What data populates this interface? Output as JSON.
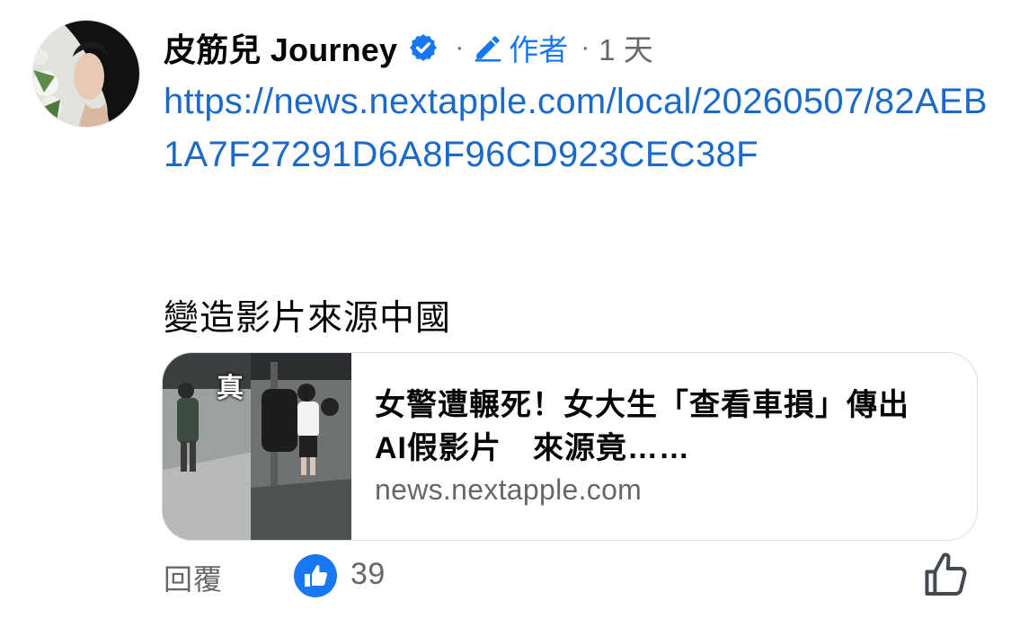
{
  "comment": {
    "author": "皮筋兒 Journey",
    "author_badge": "作者",
    "separator": "·",
    "time": "1 天",
    "link_text": "https://news.nextapple.com/local/20260507/82AEB1A7F27291D6A8F96CD923CEC38F",
    "text": "變造影片來源中國"
  },
  "link_card": {
    "thumbnail_label": "真",
    "title": "女警遭輾死！女大生「查看車損」傳出AI假影片　來源竟……",
    "domain": "news.nextapple.com"
  },
  "actions": {
    "reply_label": "回覆",
    "like_count": "39"
  },
  "icons": {
    "verified": "verified-badge-icon",
    "author": "pencil-icon",
    "like_reaction": "like-reaction-icon",
    "like_action": "thumbs-up-outline-icon"
  },
  "colors": {
    "link": "#1b6ac9",
    "accent": "#1877f2",
    "secondary_text": "#65676b",
    "card_border": "#dadde1"
  }
}
